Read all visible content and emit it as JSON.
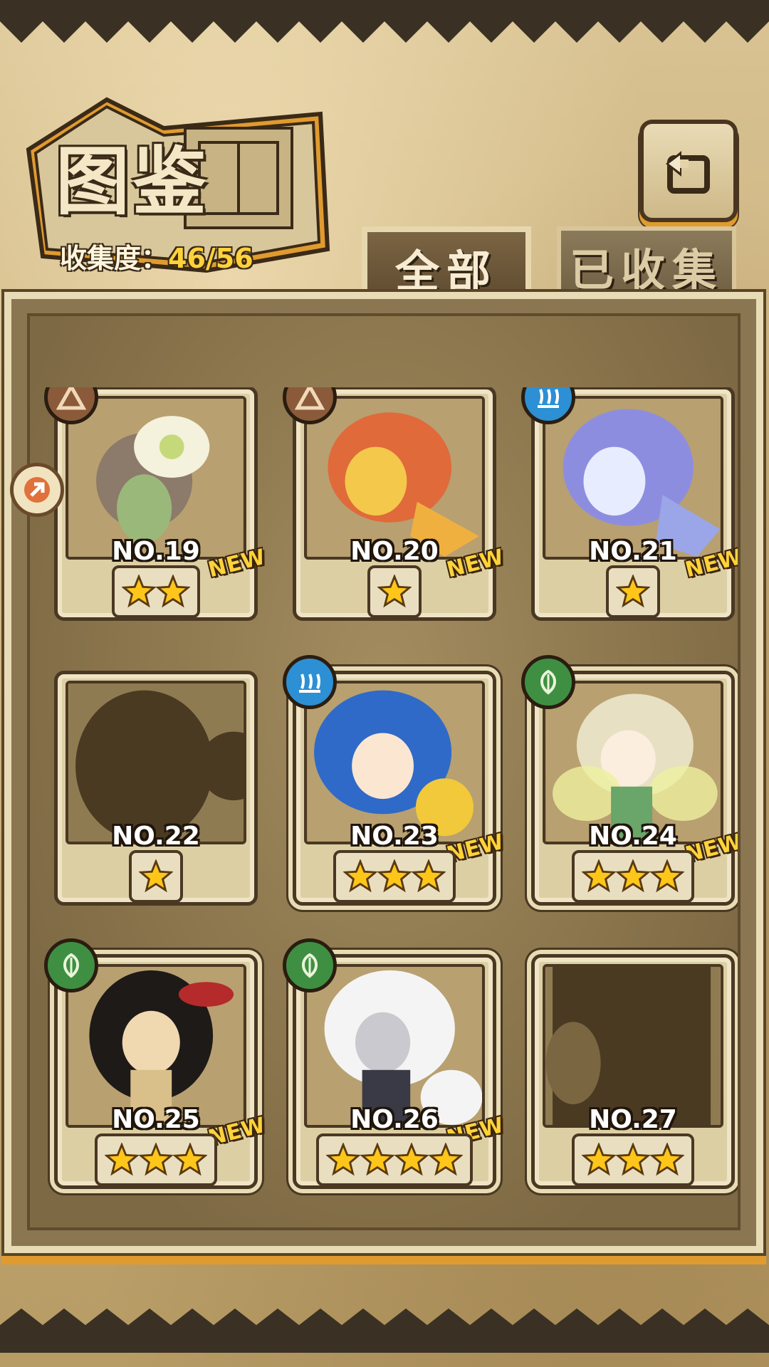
{
  "header": {
    "title": "图鉴",
    "collect_label": "收集度：",
    "collect_value": "46/56"
  },
  "tabs": [
    {
      "label": "全部",
      "active": true
    },
    {
      "label": "已收集",
      "active": false
    }
  ],
  "colors": {
    "accent_orange": "#e09b2f",
    "new_yellow": "#ffd23a",
    "water_badge": "#2d8fd4",
    "leaf_badge": "#3f8f43",
    "earth_badge": "#8a5a3a"
  },
  "cards": [
    {
      "no": "NO.19",
      "stars": 2,
      "new": "NEW",
      "element": "earth-icon",
      "collected": true
    },
    {
      "no": "NO.20",
      "stars": 1,
      "new": "NEW",
      "element": "earth-icon",
      "collected": true
    },
    {
      "no": "NO.21",
      "stars": 1,
      "new": "NEW",
      "element": "water-icon",
      "collected": true
    },
    {
      "no": "NO.22",
      "stars": 1,
      "new": "",
      "element": "",
      "collected": false
    },
    {
      "no": "NO.23",
      "stars": 3,
      "new": "NEW",
      "element": "water-icon",
      "collected": true
    },
    {
      "no": "NO.24",
      "stars": 3,
      "new": "NEW",
      "element": "leaf-icon",
      "collected": true
    },
    {
      "no": "NO.25",
      "stars": 3,
      "new": "NEW",
      "element": "leaf-icon",
      "collected": true
    },
    {
      "no": "NO.26",
      "stars": 4,
      "new": "NEW",
      "element": "leaf-icon",
      "collected": true
    },
    {
      "no": "NO.27",
      "stars": 3,
      "new": "",
      "element": "",
      "collected": false
    }
  ]
}
